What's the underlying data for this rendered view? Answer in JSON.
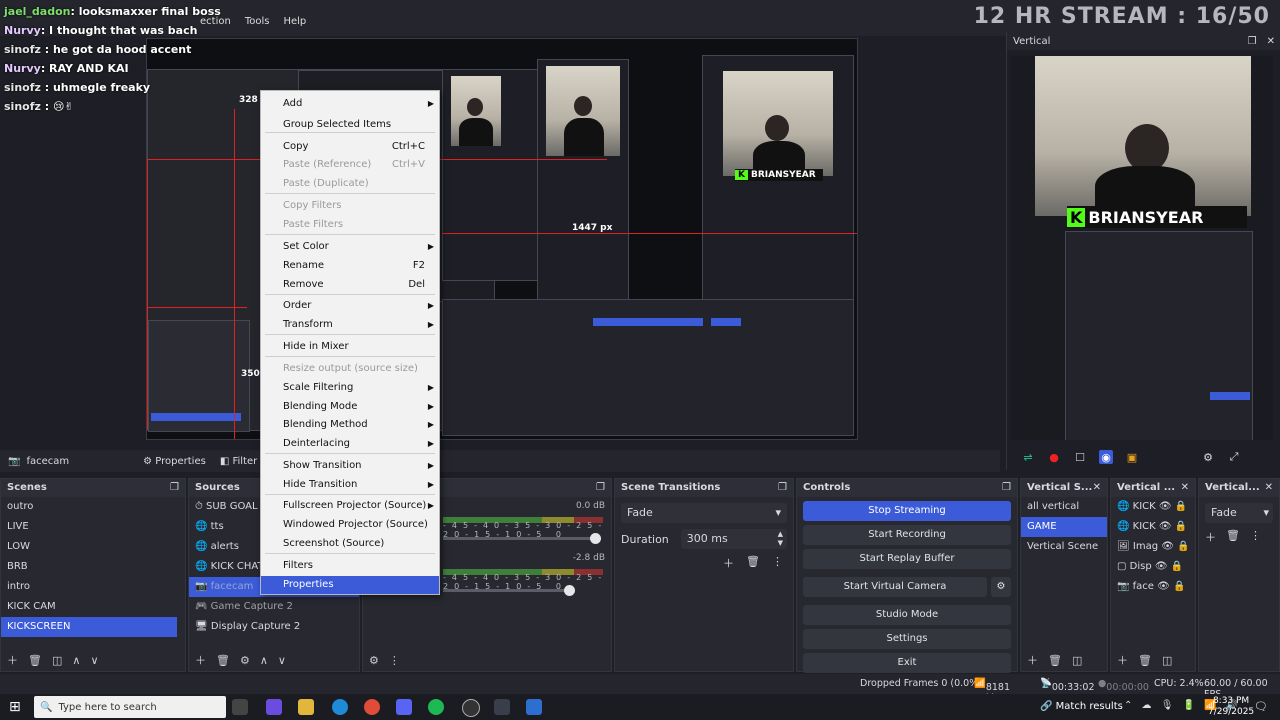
{
  "window": {
    "menu": [
      "ection",
      "Tools",
      "Help"
    ],
    "stream_title": "12 HR STREAM : 16/50"
  },
  "chat": [
    {
      "user": "jael_dadon",
      "text": "looksmaxxer final boss",
      "color": "green"
    },
    {
      "user": "Nurvy",
      "text": "I thought that was bach",
      "color": "pink"
    },
    {
      "user": "sinofz",
      "text": "he got da hood accent",
      "color": "white"
    },
    {
      "user": "Nurvy",
      "text": "RAY AND KAI",
      "color": "pink"
    },
    {
      "user": "sinofz",
      "text": "uhmegle freaky",
      "color": "white"
    },
    {
      "user": "sinofz",
      "text": "😢✌",
      "color": "white"
    }
  ],
  "preview": {
    "size_label_1": "328 p",
    "size_label_2": "1447 px",
    "size_label_3": "350 p",
    "kick_label": "BRIANSYEAR",
    "kick_k": "K"
  },
  "vertical": {
    "title": "Vertical",
    "kick_label": "BRIANSYEAR",
    "kick_k": "K"
  },
  "source_toolbar": {
    "source_name": "facecam",
    "properties_label": "Properties",
    "filters_label": "Filter"
  },
  "scenes": {
    "title": "Scenes",
    "items": [
      "outro",
      "LIVE",
      "LOW",
      "BRB",
      "intro",
      "KICK CAM",
      "KICKSCREEN"
    ],
    "selected": "KICKSCREEN"
  },
  "sources": {
    "title": "Sources",
    "items": [
      {
        "label": "SUB GOAL"
      },
      {
        "label": "tts"
      },
      {
        "label": "alerts"
      },
      {
        "label": "KICK CHAT"
      },
      {
        "label": "facecam"
      },
      {
        "label": "Game Capture 2"
      },
      {
        "label": "Display Capture 2"
      }
    ]
  },
  "mixer": {
    "db1": "0.0 dB",
    "db2": "-2.8 dB",
    "scale": [
      "45",
      "-40",
      "-35",
      "-30",
      "-25",
      "-20",
      "-15",
      "-10",
      "-5",
      "0"
    ]
  },
  "transitions": {
    "title": "Scene Transitions",
    "type": "Fade",
    "duration_label": "Duration",
    "duration_value": "300 ms"
  },
  "controls": {
    "title": "Controls",
    "buttons": [
      "Stop Streaming",
      "Start Recording",
      "Start Replay Buffer",
      "Start Virtual Camera",
      "Studio Mode",
      "Settings",
      "Exit"
    ]
  },
  "vertical_scenes": {
    "title": "Vertical S...",
    "items": [
      "all vertical",
      "GAME",
      "Vertical Scene"
    ],
    "selected": "GAME"
  },
  "vertical_sources": {
    "title": "Vertical ...",
    "items": [
      "KICK",
      "KICK",
      "Imag",
      "Disp",
      "face"
    ]
  },
  "vertical_transitions": {
    "title": "Vertical...",
    "type": "Fade"
  },
  "context_menu": {
    "items": [
      {
        "label": "Add",
        "submenu": true
      },
      {
        "label": "Group Selected Items"
      },
      {
        "label": "Copy",
        "shortcut": "Ctrl+C"
      },
      {
        "label": "Paste (Reference)",
        "shortcut": "Ctrl+V",
        "disabled": true
      },
      {
        "label": "Paste (Duplicate)",
        "disabled": true
      },
      {
        "label": "Copy Filters",
        "disabled": true
      },
      {
        "label": "Paste Filters",
        "disabled": true
      },
      {
        "label": "Set Color",
        "submenu": true
      },
      {
        "label": "Rename",
        "shortcut": "F2"
      },
      {
        "label": "Remove",
        "shortcut": "Del"
      },
      {
        "label": "Order",
        "submenu": true
      },
      {
        "label": "Transform",
        "submenu": true
      },
      {
        "label": "Hide in Mixer"
      },
      {
        "label": "Resize output (source size)",
        "disabled": true
      },
      {
        "label": "Scale Filtering",
        "submenu": true
      },
      {
        "label": "Blending Mode",
        "submenu": true
      },
      {
        "label": "Blending Method",
        "submenu": true
      },
      {
        "label": "Deinterlacing",
        "submenu": true
      },
      {
        "label": "Show Transition",
        "submenu": true
      },
      {
        "label": "Hide Transition",
        "submenu": true
      },
      {
        "label": "Fullscreen Projector (Source)",
        "submenu": true
      },
      {
        "label": "Windowed Projector (Source)"
      },
      {
        "label": "Screenshot (Source)"
      },
      {
        "label": "Filters"
      },
      {
        "label": "Properties",
        "highlighted": true
      }
    ]
  },
  "status": {
    "dropped": "Dropped Frames 0 (0.0%)",
    "bitrate": "8181 kbps",
    "stream_time": "00:33:02",
    "rec_time": "00:00:00",
    "cpu": "CPU: 2.4%",
    "fps": "60.00 / 60.00 FPS"
  },
  "taskbar": {
    "search_placeholder": "Type here to search",
    "match_results": "Match results",
    "time": "8:33 PM",
    "date": "7/29/2025"
  },
  "colors": {
    "accent": "#3b5bd9",
    "kick_green": "#53fc18",
    "guide_red": "#dd2222"
  }
}
